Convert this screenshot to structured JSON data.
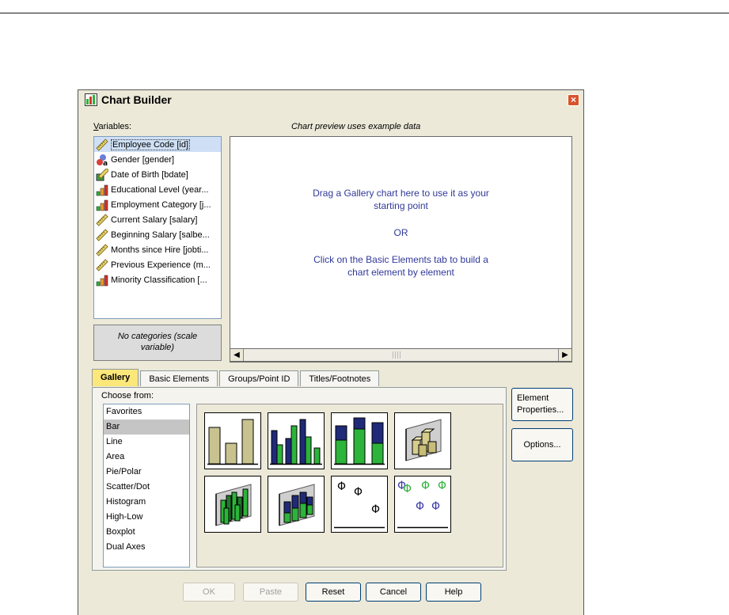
{
  "window": {
    "title": "Chart Builder"
  },
  "variables": {
    "label": "Variables:",
    "label_underline": "V",
    "label_rest": "ariables:",
    "items": [
      {
        "label": "Employee Code [id]",
        "icon": "scale-ruler-icon",
        "selected": true
      },
      {
        "label": "Gender [gender]",
        "icon": "nominal-icon",
        "selected": false
      },
      {
        "label": "Date of Birth [bdate]",
        "icon": "date-scale-icon",
        "selected": false
      },
      {
        "label": "Educational Level (year...",
        "icon": "ordinal-bar-icon",
        "selected": false
      },
      {
        "label": "Employment Category [j...",
        "icon": "ordinal-bar-icon",
        "selected": false
      },
      {
        "label": "Current Salary [salary]",
        "icon": "scale-ruler-icon",
        "selected": false
      },
      {
        "label": "Beginning Salary [salbe...",
        "icon": "scale-ruler-icon",
        "selected": false
      },
      {
        "label": "Months since Hire [jobti...",
        "icon": "scale-ruler-icon",
        "selected": false
      },
      {
        "label": "Previous Experience (m...",
        "icon": "scale-ruler-icon",
        "selected": false
      },
      {
        "label": "Minority Classification [...",
        "icon": "ordinal-bar-icon",
        "selected": false
      }
    ],
    "categories_line1": "No categories (scale",
    "categories_line2": "variable)"
  },
  "preview": {
    "label": "Chart preview uses example data",
    "line1": "Drag a Gallery chart here to use it as your",
    "line2": "starting point",
    "line3": "OR",
    "line4": "Click on the Basic Elements tab to build a",
    "line5": "chart element by element"
  },
  "tabs": [
    "Gallery",
    "Basic Elements",
    "Groups/Point ID",
    "Titles/Footnotes"
  ],
  "active_tab": "Gallery",
  "gallery": {
    "choose_label": "Choose from:",
    "items": [
      "Favorites",
      "Bar",
      "Line",
      "Area",
      "Pie/Polar",
      "Scatter/Dot",
      "Histogram",
      "High-Low",
      "Boxplot",
      "Dual Axes"
    ],
    "selected": "Bar"
  },
  "side_buttons": {
    "element_line1": "Element",
    "element_line2": "Properties...",
    "options": "Options..."
  },
  "buttons": {
    "ok": "OK",
    "paste": "Paste",
    "reset": "Reset",
    "cancel": "Cancel",
    "help": "Help"
  },
  "colors": {
    "accent_tab": "#fbe77a",
    "preview_text": "#31399a",
    "bar_tan": "#c8c28f",
    "bar_navy": "#1f2a78",
    "bar_green": "#2db43a",
    "phi_blue": "#3a3aa8"
  }
}
